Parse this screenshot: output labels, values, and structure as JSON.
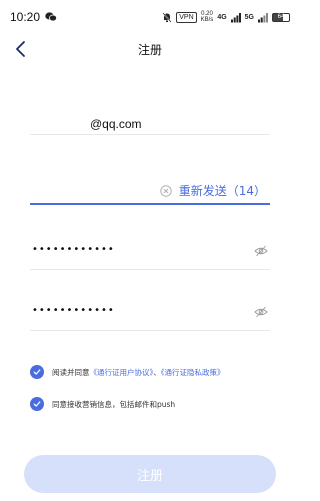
{
  "status_bar": {
    "time": "10:20",
    "vpn": "VPN",
    "speed_value": "0.20",
    "speed_unit": "KB/s",
    "network_1": "4G",
    "network_2": "5G",
    "battery": "64"
  },
  "header": {
    "title": "注册"
  },
  "form": {
    "email_value": "@qq.com",
    "resend_label": "重新发送（14）",
    "password_mask": "••••••••••••",
    "confirm_password_mask": "••••••••••••"
  },
  "agreements": {
    "terms_prefix": "阅读并同意",
    "terms_link_user": "《通行证用户协议》",
    "terms_separator": "、",
    "terms_link_privacy": "《通行证隐私政策》",
    "marketing_text": "同意接收营销信息，包括邮件和push"
  },
  "actions": {
    "register_label": "注册"
  },
  "colors": {
    "accent": "#4a6ce0",
    "button_disabled": "#d7e0fb"
  }
}
